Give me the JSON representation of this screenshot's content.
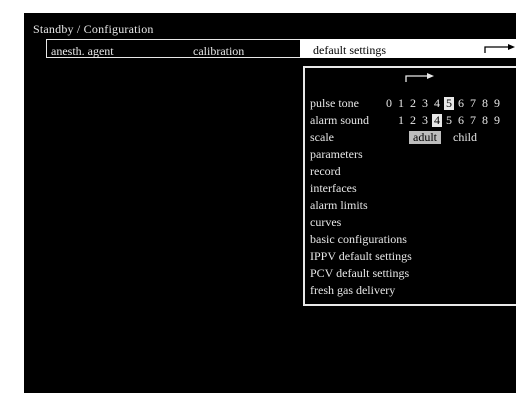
{
  "header": {
    "title": "Standby / Configuration"
  },
  "tabs": {
    "anesth_agent": "anesth. agent",
    "calibration": "calibration",
    "default_settings": "default settings"
  },
  "icons": {
    "tab_arrow": "right-arrow-icon",
    "panel_arrow": "right-arrow-icon"
  },
  "colors": {
    "screen_bg": "#000000",
    "text": "#e8e8e8",
    "selected_bg": "#e8e8e8",
    "scale_selected_bg": "#bdbdbd"
  },
  "menu": {
    "pulse_tone": {
      "label": "pulse tone",
      "digits": [
        "0",
        "1",
        "2",
        "3",
        "4",
        "5",
        "6",
        "7",
        "8",
        "9"
      ],
      "selected": "5"
    },
    "alarm_sound": {
      "label": "alarm sound",
      "digits": [
        "1",
        "2",
        "3",
        "4",
        "5",
        "6",
        "7",
        "8",
        "9"
      ],
      "selected": "4"
    },
    "scale": {
      "label": "scale",
      "options": [
        "adult",
        "child"
      ],
      "selected": "adult"
    },
    "parameters": "parameters",
    "record": "record",
    "interfaces": "interfaces",
    "alarm_limits": "alarm limits",
    "curves": "curves",
    "basic_configurations": "basic configurations",
    "ippv_default_settings": "IPPV default settings",
    "pcv_default_settings": "PCV default settings",
    "fresh_gas_delivery": "fresh gas delivery"
  }
}
